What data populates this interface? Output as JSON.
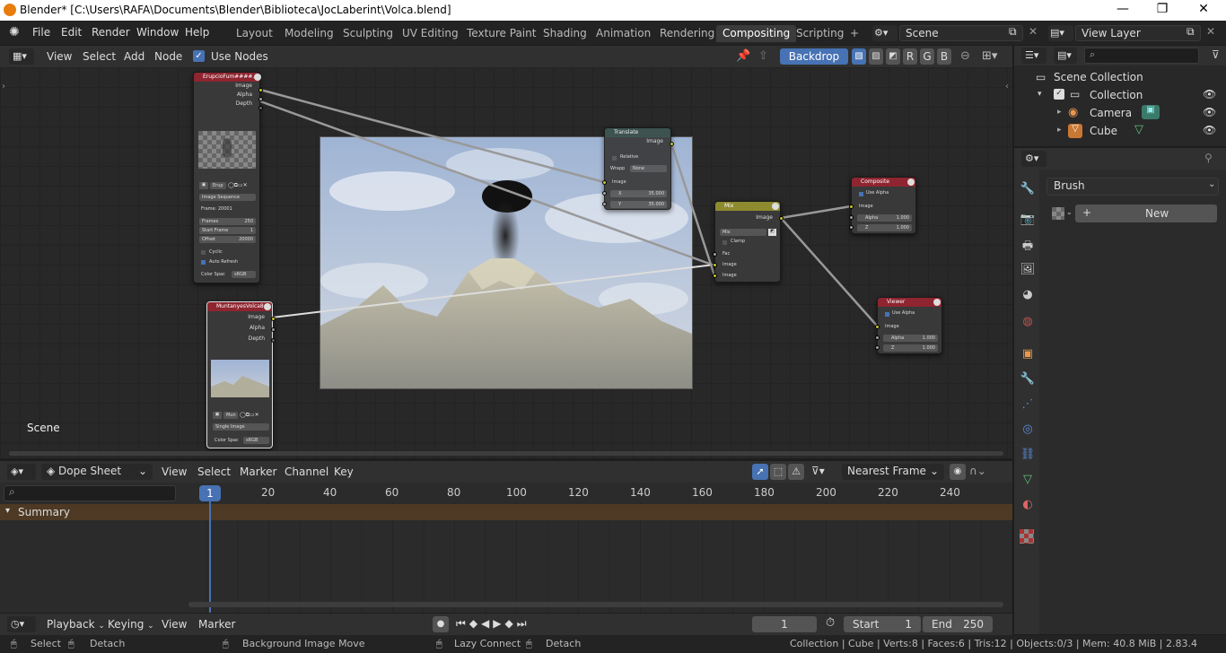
{
  "window": {
    "title": "Blender* [C:\\Users\\RAFA\\Documents\\Blender\\Biblioteca\\JocLaberint\\Volca.blend]",
    "minimize": "—",
    "maximize": "❐",
    "close": "✕"
  },
  "menu": [
    "File",
    "Edit",
    "Render",
    "Window",
    "Help"
  ],
  "workspaces": [
    "Layout",
    "Modeling",
    "Sculpting",
    "UV Editing",
    "Texture Paint",
    "Shading",
    "Animation",
    "Rendering",
    "Compositing",
    "Scripting"
  ],
  "add_workspace": "+",
  "scene": {
    "name": "Scene",
    "view_layer": "View Layer"
  },
  "node_editor": {
    "menus": [
      "View",
      "Select",
      "Add",
      "Node"
    ],
    "use_nodes": "Use Nodes",
    "backdrop": "Backdrop",
    "channels": [
      "R",
      "G",
      "B"
    ],
    "scene_label": "Scene"
  },
  "nodes": {
    "image1": {
      "title": "ErupcioFum####...",
      "outputs": [
        "Image",
        "Alpha",
        "Depth"
      ],
      "name": "Erup",
      "source": "Image Sequence",
      "frame": "Frame: 20001",
      "frames_label": "Frames",
      "frames": "250",
      "start_label": "Start Frame",
      "start": "1",
      "offset_label": "Offset",
      "offset": "20000",
      "cyclic": "Cyclic",
      "auto_refresh": "Auto Refresh",
      "colorspace_label": "Color Spac",
      "colorspace": "sRGB"
    },
    "image2": {
      "title": "MuntanyesVolca8...",
      "outputs": [
        "Image",
        "Alpha",
        "Depth"
      ],
      "name": "Mun",
      "source": "Single Image",
      "colorspace_label": "Color Spac",
      "colorspace": "sRGB"
    },
    "translate": {
      "title": "Translate",
      "output": "Image",
      "relative": "Relative",
      "wrap_label": "Wrapp",
      "wrap": "None",
      "input": "Image",
      "x_label": "X",
      "x": "35.000",
      "y_label": "Y",
      "y": "35.000"
    },
    "mix": {
      "title": "Mix",
      "output": "Image",
      "mode": "Mix",
      "clamp": "Clamp",
      "inputs": [
        "Fac",
        "Image",
        "Image"
      ]
    },
    "composite": {
      "title": "Composite",
      "use_alpha": "Use Alpha",
      "input": "Image",
      "alpha_label": "Alpha",
      "alpha": "1.000",
      "z_label": "Z",
      "z": "1.000"
    },
    "viewer": {
      "title": "Viewer",
      "use_alpha": "Use Alpha",
      "input": "Image",
      "alpha_label": "Alpha",
      "alpha": "1.000",
      "z_label": "Z",
      "z": "1.000"
    }
  },
  "outliner": {
    "root": "Scene Collection",
    "collection": "Collection",
    "items": [
      "Camera",
      "Cube"
    ]
  },
  "properties": {
    "brush_label": "Brush",
    "new_label": "New",
    "new_plus": "+"
  },
  "dopesheet": {
    "mode": "Dope Sheet",
    "menus": [
      "View",
      "Select",
      "Marker",
      "Channel",
      "Key"
    ],
    "interpolation": "Nearest Frame",
    "current_frame": "1",
    "ticks": [
      "20",
      "40",
      "60",
      "80",
      "100",
      "120",
      "140",
      "160",
      "180",
      "200",
      "220",
      "240"
    ],
    "summary": "Summary"
  },
  "timeline": {
    "menus": [
      "Playback",
      "Keying",
      "View",
      "Marker"
    ],
    "frame": "1",
    "start_label": "Start",
    "start": "1",
    "end_label": "End",
    "end": "250"
  },
  "status": {
    "select": "Select",
    "detach": "Detach",
    "bg_move": "Background Image Move",
    "lazy_connect": "Lazy Connect",
    "detach2": "Detach",
    "info": "Collection | Cube | Verts:8 | Faces:6 | Tris:12 | Objects:0/3 | Mem: 40.8 MiB | 2.83.4"
  },
  "colors": {
    "accent": "#4772b3",
    "header_red": "#8e2530",
    "header_teal": "#3e5753",
    "header_yellow": "#8e8a2f",
    "socket_yellow": "#c7c729"
  }
}
